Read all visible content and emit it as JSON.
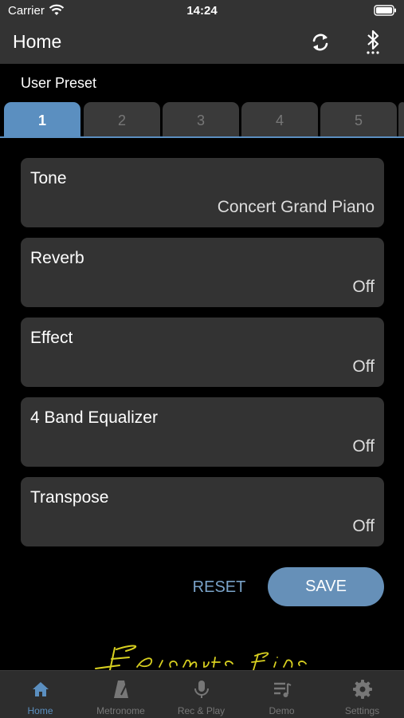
{
  "status_bar": {
    "carrier": "Carrier",
    "time": "14:24"
  },
  "nav": {
    "title": "Home"
  },
  "preset": {
    "label": "User Preset",
    "tabs": [
      "1",
      "2",
      "3",
      "4",
      "5"
    ],
    "active_tab": "1"
  },
  "settings": [
    {
      "title": "Tone",
      "value": "Concert Grand Piano"
    },
    {
      "title": "Reverb",
      "value": "Off"
    },
    {
      "title": "Effect",
      "value": "Off"
    },
    {
      "title": "4 Band Equalizer",
      "value": "Off"
    },
    {
      "title": "Transpose",
      "value": "Off"
    }
  ],
  "actions": {
    "reset": "RESET",
    "save": "SAVE"
  },
  "logo_text": "Piamute Fine",
  "tab_bar": [
    {
      "label": "Home",
      "icon": "home-icon"
    },
    {
      "label": "Metronome",
      "icon": "metronome-icon"
    },
    {
      "label": "Rec & Play",
      "icon": "microphone-icon"
    },
    {
      "label": "Demo",
      "icon": "playlist-icon"
    },
    {
      "label": "Settings",
      "icon": "gear-icon"
    }
  ],
  "colors": {
    "accent": "#5b8fc0",
    "card": "#333333",
    "background": "#000000"
  }
}
